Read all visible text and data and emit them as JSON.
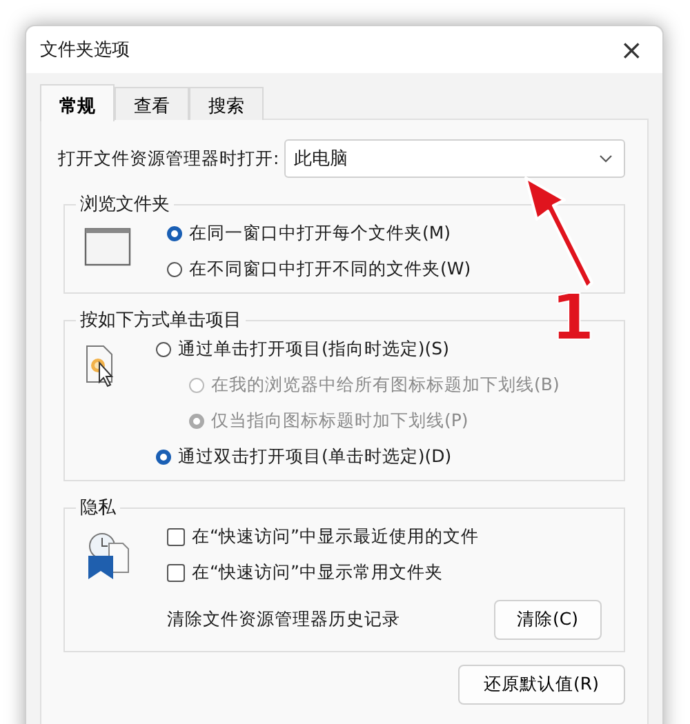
{
  "window": {
    "title": "文件夹选项",
    "close": "×"
  },
  "tabs": [
    {
      "label": "常规",
      "selected": true
    },
    {
      "label": "查看",
      "selected": false
    },
    {
      "label": "搜索",
      "selected": false
    }
  ],
  "open_in": {
    "label": "打开文件资源管理器时打开:",
    "value": "此电脑"
  },
  "browse_folders": {
    "title": "浏览文件夹",
    "options": [
      {
        "label": "在同一窗口中打开每个文件夹(M)",
        "selected": true,
        "disabled": false
      },
      {
        "label": "在不同窗口中打开不同的文件夹(W)",
        "selected": false,
        "disabled": false
      }
    ]
  },
  "click_items": {
    "title": "按如下方式单击项目",
    "options": [
      {
        "label": "通过单击打开项目(指向时选定)(S)",
        "selected": false,
        "disabled": false,
        "children": [
          {
            "label": "在我的浏览器中给所有图标标题加下划线(B)",
            "selected": false,
            "disabled": true
          },
          {
            "label": "仅当指向图标标题时加下划线(P)",
            "selected": true,
            "disabled": true
          }
        ]
      },
      {
        "label": "通过双击打开项目(单击时选定)(D)",
        "selected": true,
        "disabled": false
      }
    ]
  },
  "privacy": {
    "title": "隐私",
    "checkboxes": [
      {
        "label": "在“快速访问”中显示最近使用的文件",
        "checked": false
      },
      {
        "label": "在“快速访问”中显示常用文件夹",
        "checked": false
      }
    ],
    "clear_label": "清除文件资源管理器历史记录",
    "clear_button": "清除(C)"
  },
  "restore_button": "还原默认值(R)",
  "annotation": {
    "number": "1"
  }
}
